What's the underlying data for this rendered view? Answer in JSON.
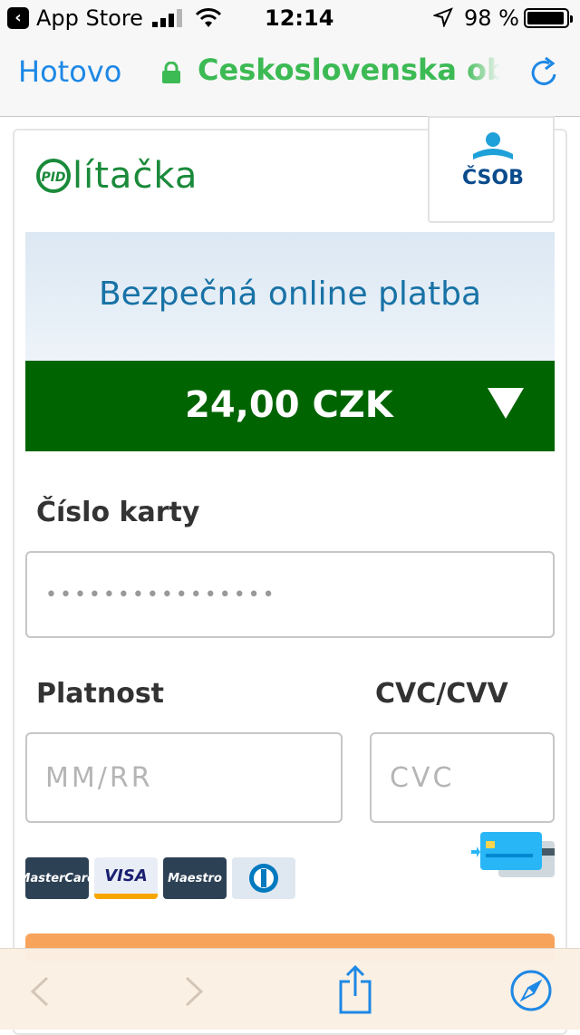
{
  "status_bar": {
    "back_app": "App Store",
    "time": "12:14",
    "battery": "98 %"
  },
  "url_bar": {
    "done": "Hotovo",
    "url": "Ceskoslovenska obchodni banka"
  },
  "header": {
    "brand": "lítačka",
    "brand_badge": "PID",
    "bank": "ČSOB"
  },
  "banner": {
    "title": "Bezpečná online platba"
  },
  "amount_bar": {
    "amount": "24,00 CZK"
  },
  "form": {
    "card_number_label": "Číslo karty",
    "card_number_value": "••••••••••••••••",
    "validity_label": "Platnost",
    "validity_placeholder": "MM/RR",
    "cvc_label": "CVC/CVV",
    "cvc_placeholder": "CVC"
  },
  "card_brands": [
    {
      "name": "MasterCard"
    },
    {
      "name": "VISA"
    },
    {
      "name": "Maestro"
    },
    {
      "name": "Diners"
    }
  ],
  "colors": {
    "accent_blue": "#1e88e5",
    "secure_green": "#3cba54",
    "amount_bar": "#006400",
    "banner_text": "#1872a6",
    "pay_button": "#f7a35c"
  }
}
